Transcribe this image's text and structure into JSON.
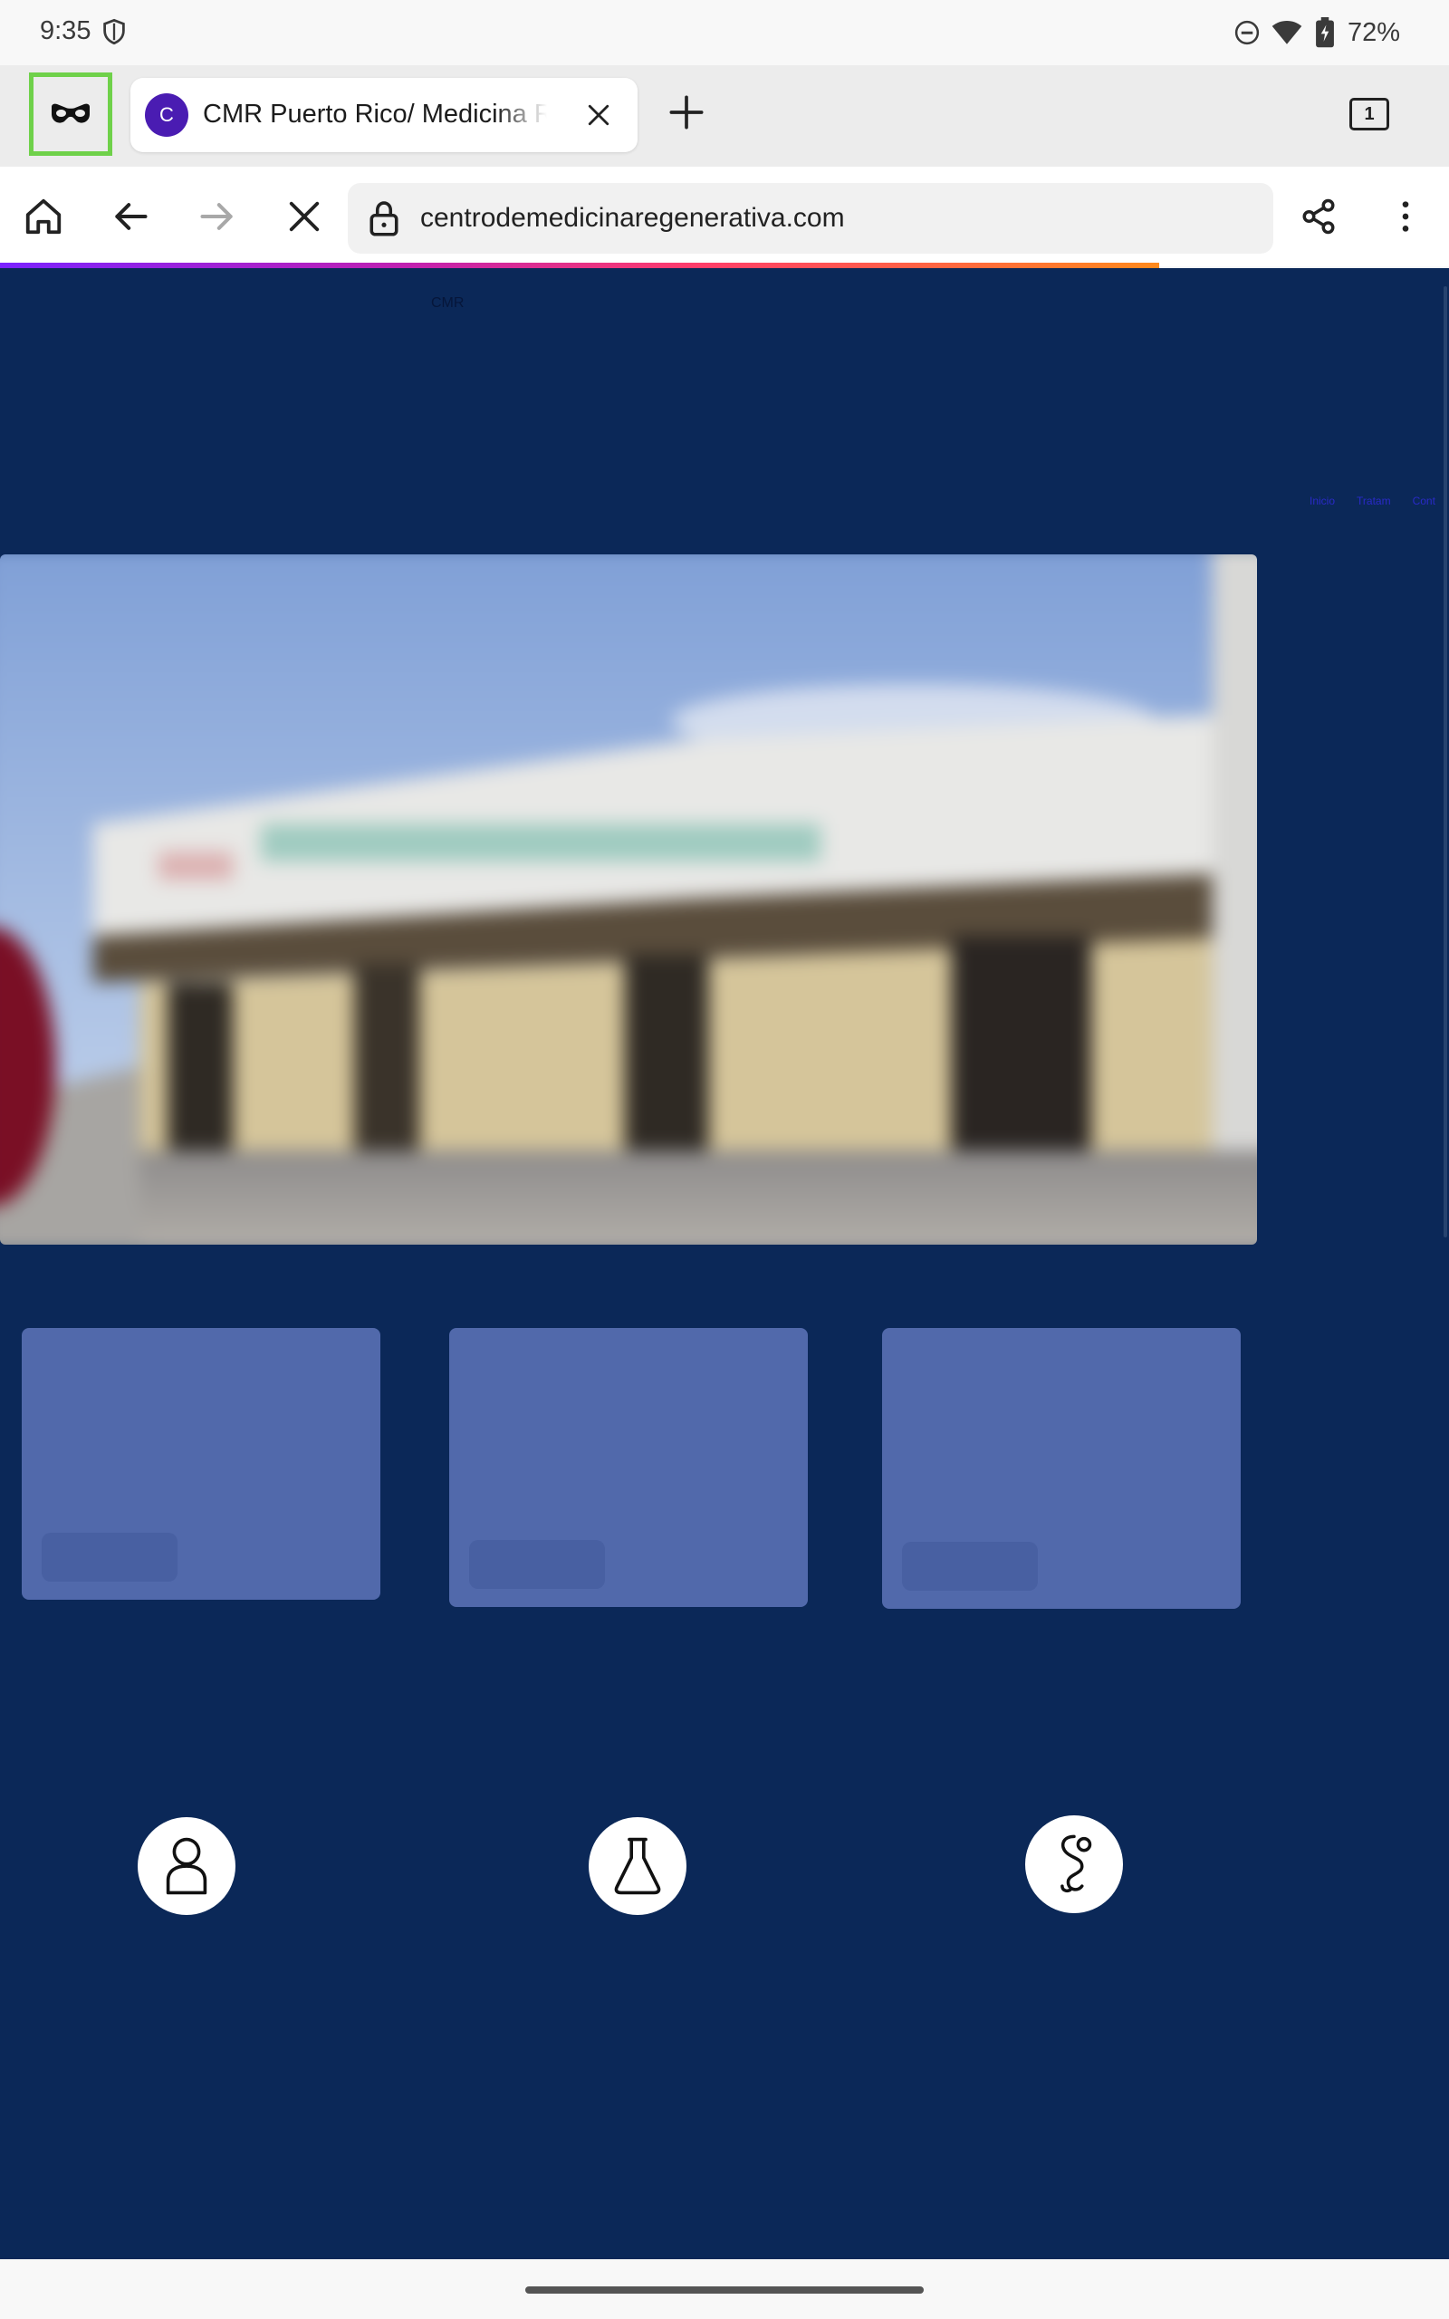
{
  "status_bar": {
    "time": "9:35",
    "battery": "72%",
    "icons": [
      "shield-icon",
      "do-not-disturb-icon",
      "wifi-icon",
      "battery-icon"
    ]
  },
  "tab_strip": {
    "incognito_icon": "incognito-mask-icon",
    "active_tab": {
      "favicon_letter": "C",
      "title": "CMR Puerto Rico/ Medicina Regenerativa"
    },
    "tab_count": "1"
  },
  "toolbar": {
    "url": "centrodemedicinaregenerativa.com",
    "icons": [
      "home-icon",
      "back-icon",
      "forward-icon",
      "stop-icon",
      "lock-icon",
      "share-icon",
      "more-icon"
    ]
  },
  "page": {
    "logo_text": "CMR",
    "nav_links": [
      "Inicio",
      "Tratam",
      "Cont"
    ],
    "service_icons": [
      "person-icon",
      "flask-icon",
      "stethoscope-icon"
    ]
  },
  "colors": {
    "page_background": "#0b2858",
    "card": "#5169ab",
    "incognito_highlight": "#6fd14a",
    "favicon": "#4a1cb2"
  }
}
